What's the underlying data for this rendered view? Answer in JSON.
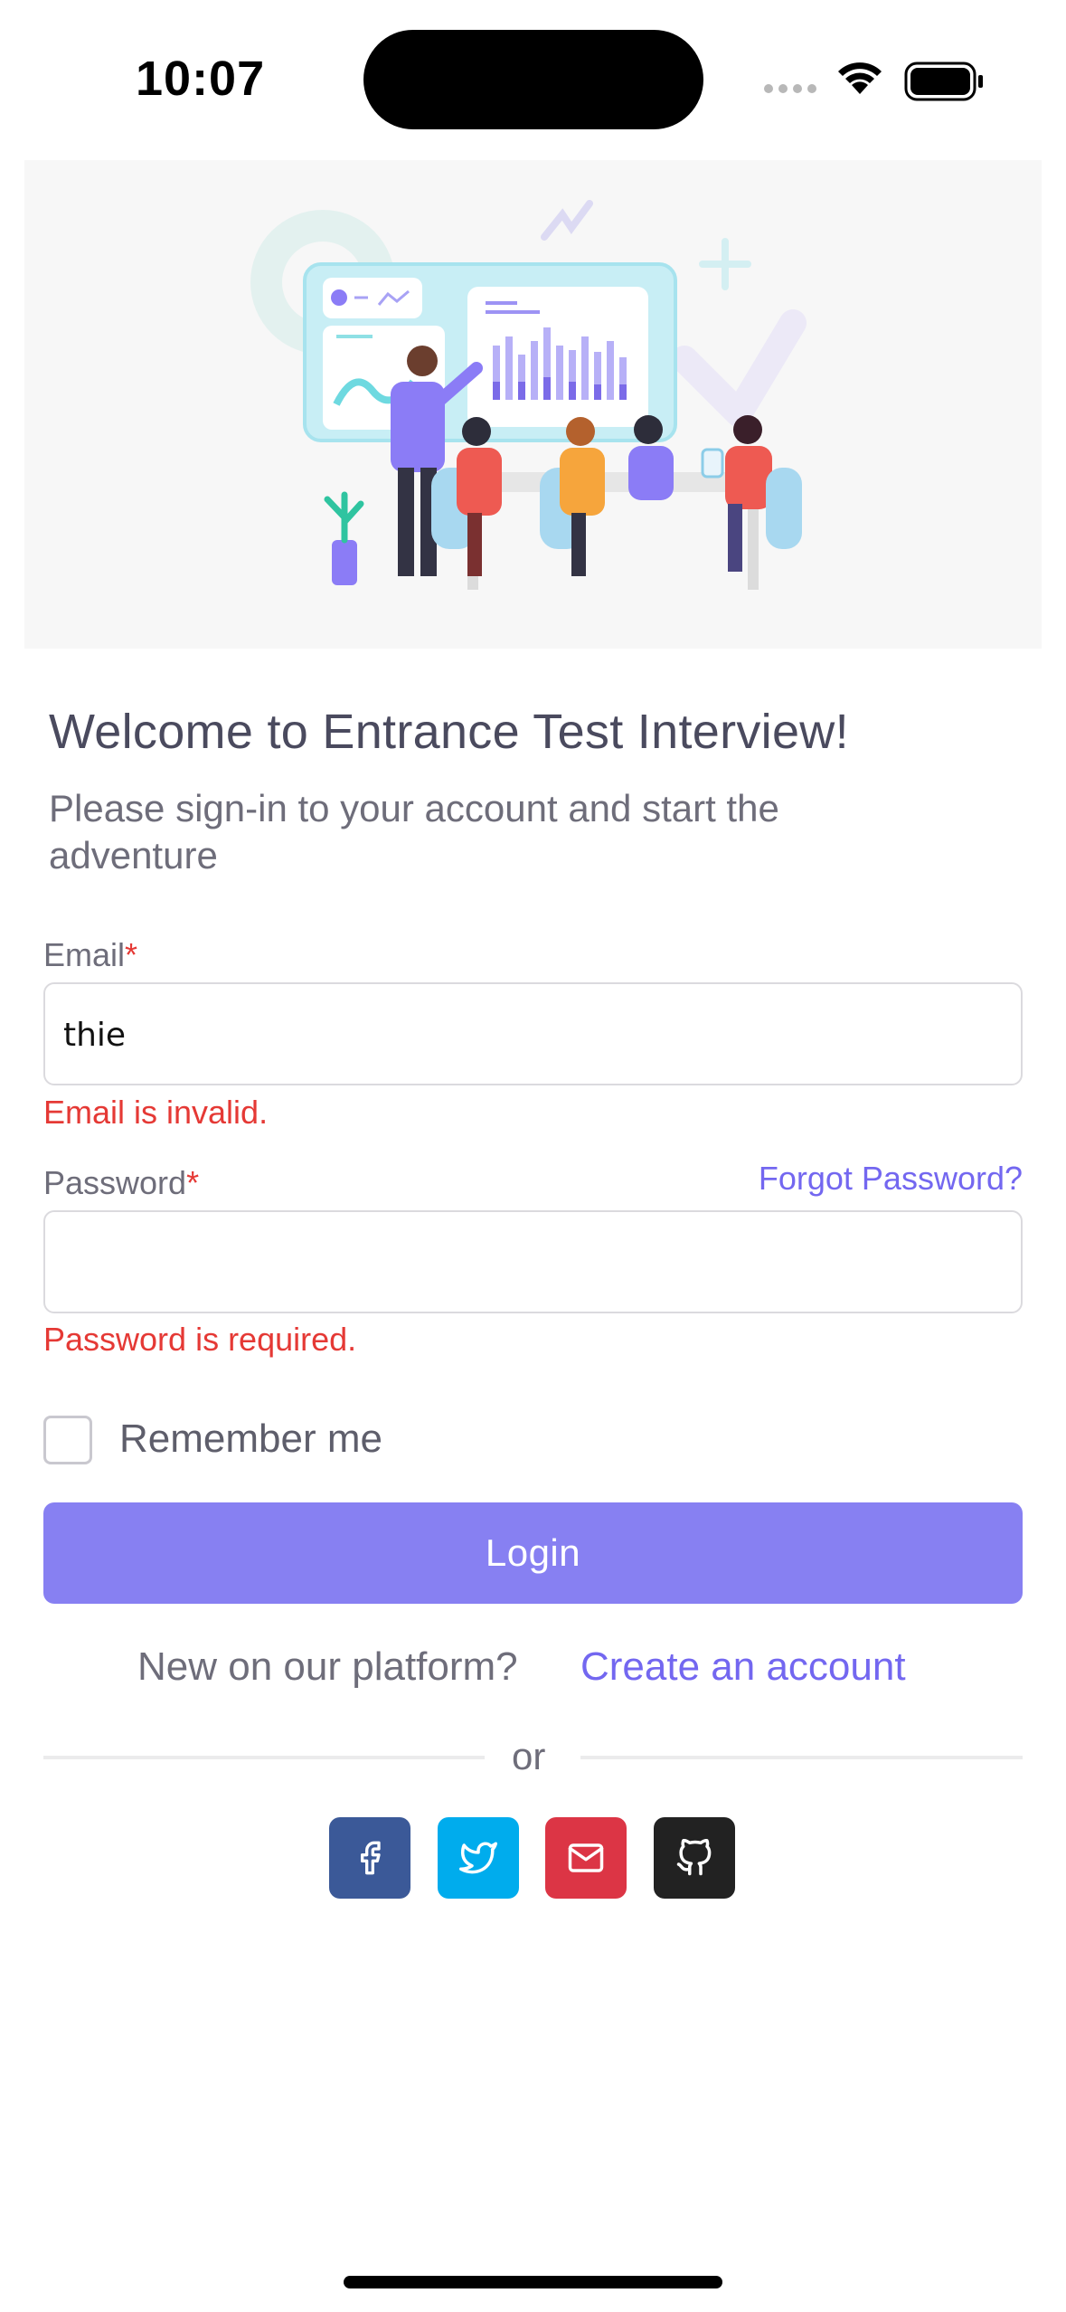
{
  "status_bar": {
    "time": "10:07"
  },
  "hero": {
    "illustration": "team-meeting-dashboard-illustration"
  },
  "header": {
    "title": "Welcome to Entrance Test Interview!",
    "subtitle": "Please sign-in to your account and start the adventure"
  },
  "form": {
    "email_label": "Email",
    "email_value": "thie",
    "email_error": "Email is invalid.",
    "password_label": "Password",
    "password_value": "",
    "password_error": "Password is required.",
    "forgot_password": "Forgot Password?",
    "required_mark": "*",
    "remember_me": "Remember me",
    "login_button": "Login"
  },
  "signup": {
    "prompt": "New on our platform?",
    "link": "Create an account"
  },
  "divider": {
    "text": "or"
  },
  "social": [
    {
      "name": "facebook-icon",
      "color": "#3b5998"
    },
    {
      "name": "twitter-icon",
      "color": "#00aced"
    },
    {
      "name": "mail-icon",
      "color": "#dc3545"
    },
    {
      "name": "github-icon",
      "color": "#222222"
    }
  ],
  "colors": {
    "primary": "#7367f0",
    "button": "#8780f2",
    "error": "#e53935"
  }
}
